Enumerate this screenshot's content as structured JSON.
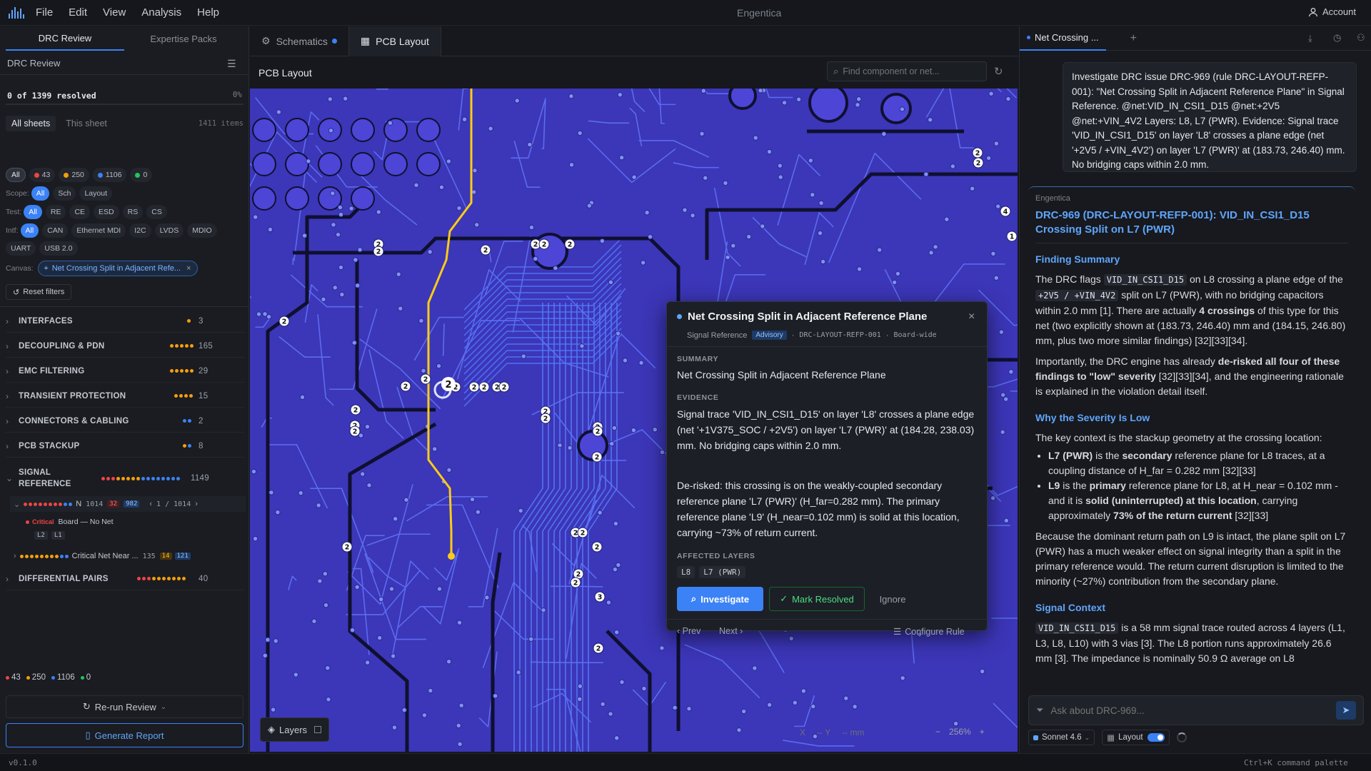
{
  "menu": {
    "items": [
      "File",
      "Edit",
      "View",
      "Analysis",
      "Help"
    ],
    "app_title": "Engentica",
    "account": "Account"
  },
  "left": {
    "tabs": [
      "DRC Review",
      "Expertise Packs"
    ],
    "header": "DRC Review",
    "progress": {
      "text": "0 of 1399 resolved",
      "percent": "0%",
      "fraction": 0
    },
    "sheet_tabs": [
      "All sheets",
      "This sheet"
    ],
    "items_count": "1411 items",
    "severity_chips": [
      {
        "label": "All"
      },
      {
        "label": "43",
        "color": "#ef4444"
      },
      {
        "label": "250",
        "color": "#f59e0b"
      },
      {
        "label": "1106",
        "color": "#3b82f6"
      },
      {
        "label": "0",
        "color": "#22c55e"
      }
    ],
    "scope": {
      "label": "Scope:",
      "chips": [
        "All",
        "Sch",
        "Layout"
      ]
    },
    "test": {
      "label": "Test:",
      "chips": [
        "All",
        "RE",
        "CE",
        "ESD",
        "RS",
        "CS"
      ]
    },
    "intf": {
      "label": "Intf:",
      "chips": [
        "All",
        "CAN",
        "Ethernet MDI",
        "I2C",
        "LVDS",
        "MDIO"
      ]
    },
    "intf2": {
      "chips": [
        "UART",
        "USB 2.0"
      ]
    },
    "canvas": {
      "label": "Canvas:",
      "value": "Net Crossing Split in Adjacent Refe..."
    },
    "reset": "Reset filters",
    "categories": [
      {
        "name": "INTERFACES",
        "count": "3",
        "dots": [
          "#f59e0b"
        ]
      },
      {
        "name": "DECOUPLING & PDN",
        "count": "165",
        "dots": [
          "#f59e0b",
          "#f59e0b",
          "#f59e0b",
          "#f59e0b",
          "#f59e0b"
        ]
      },
      {
        "name": "EMC FILTERING",
        "count": "29",
        "dots": [
          "#f59e0b",
          "#f59e0b",
          "#f59e0b",
          "#f59e0b",
          "#f59e0b"
        ]
      },
      {
        "name": "TRANSIENT PROTECTION",
        "count": "15",
        "dots": [
          "#f59e0b",
          "#f59e0b",
          "#f59e0b",
          "#f59e0b"
        ]
      },
      {
        "name": "CONNECTORS & CABLING",
        "count": "2",
        "dots": [
          "#3b82f6",
          "#3b82f6"
        ]
      },
      {
        "name": "PCB STACKUP",
        "count": "8",
        "dots": [
          "#f59e0b",
          "#3b82f6"
        ]
      }
    ],
    "signal_ref": {
      "name1": "SIGNAL",
      "name2": "REFERENCE",
      "count": "1149"
    },
    "sub1": {
      "label": "N",
      "count": "1014",
      "red": "32",
      "blue": "982",
      "pager": "1 / 1014"
    },
    "item": {
      "severity": "Critical",
      "text": "Board — No Net",
      "layers": [
        "L2",
        "L1"
      ]
    },
    "sub2": {
      "label": "Critical Net Near ...",
      "count": "135",
      "amber": "14",
      "blue": "121"
    },
    "diff": {
      "name": "DIFFERENTIAL PAIRS",
      "count": "40"
    },
    "footer_counts": [
      {
        "label": "43",
        "color": "#ef4444"
      },
      {
        "label": "250",
        "color": "#f59e0b"
      },
      {
        "label": "1106",
        "color": "#3b82f6"
      },
      {
        "label": "0",
        "color": "#22c55e"
      }
    ],
    "rerun": "Re-run Review",
    "generate": "Generate Report"
  },
  "center": {
    "tabs": [
      "Schematics",
      "PCB Layout"
    ],
    "title": "PCB Layout",
    "search_placeholder": "Find component or net...",
    "layers_btn": "Layers",
    "coords": {
      "x": "X",
      "y": "-- Y",
      "unit": "-- mm"
    },
    "zoom": "256%",
    "popup": {
      "title": "Net Crossing Split in Adjacent Reference Plane",
      "category": "Signal Reference",
      "badge": "Advisory",
      "rule": "DRC-LAYOUT-REFP-001",
      "scope": "Board-wide",
      "summary_label": "SUMMARY",
      "summary": "Net Crossing Split in Adjacent Reference Plane",
      "evidence_label": "EVIDENCE",
      "evidence1": "Signal trace 'VID_IN_CSI1_D15' on layer 'L8' crosses a plane edge (net '+1V375_SOC / +2V5') on layer 'L7 (PWR)' at (184.28, 238.03) mm. No bridging caps within 2.0 mm.",
      "evidence2": "De-risked: this crossing is on the weakly-coupled secondary reference plane 'L7 (PWR)' (H_far=0.282 mm). The primary reference plane 'L9' (H_near=0.102 mm) is solid at this location, carrying ~73% of return current.",
      "affected_label": "AFFECTED LAYERS",
      "layers": [
        "L8",
        "L7 (PWR)"
      ],
      "investigate": "Investigate",
      "mark_resolved": "Mark Resolved",
      "ignore": "Ignore",
      "prev": "‹ Prev",
      "next": "Next ›",
      "configure": "Configure Rule"
    }
  },
  "right": {
    "tab": "Net Crossing ...",
    "query": "Investigate DRC issue DRC-969 (rule DRC-LAYOUT-REFP-001): \"Net Crossing Split in Adjacent Reference Plane\" in Signal Reference. @net:VID_IN_CSI1_D15 @net:+2V5 @net:+VIN_4V2 Layers: L8, L7 (PWR). Evidence: Signal trace 'VID_IN_CSI1_D15' on layer 'L8' crosses a plane edge (net '+2V5 / +VIN_4V2') on layer 'L7 (PWR)' at (183.73, 246.40) mm. No bridging caps within 2.0 mm.",
    "author": "Engentica",
    "heading": "DRC-969 (DRC-LAYOUT-REFP-001): VID_IN_CSI1_D15 Crossing Split on L7 (PWR)",
    "s1": "Finding Summary",
    "p1a": "The DRC flags",
    "p1code1": "VID_IN_CSI1_D15",
    "p1b": "on L8 crossing a plane edge of the",
    "p1code2": "+2V5 / +VIN_4V2",
    "p1c": "split on L7 (PWR), with no bridging capacitors within 2.0 mm [1]. There are actually",
    "p1bold": "4 crossings",
    "p1d": "of this type for this net (two explicitly shown at (183.73, 246.40) mm and (184.15, 246.80) mm, plus two more similar findings) [32][33][34].",
    "p2a": "Importantly, the DRC engine has already",
    "p2bold": "de-risked all four of these findings to \"low\" severity",
    "p2b": "[32][33][34], and the engineering rationale is explained in the violation detail itself.",
    "s2": "Why the Severity Is Low",
    "p3": "The key context is the stackup geometry at the crossing location:",
    "b1bold": "L7 (PWR)",
    "b1a": "is the",
    "b1bold2": "secondary",
    "b1b": "reference plane for L8 traces, at a coupling distance of H_far = 0.282 mm [32][33]",
    "b2bold": "L9",
    "b2a": "is the",
    "b2bold2": "primary",
    "b2b": "reference plane for L8, at H_near = 0.102 mm - and it is",
    "b2bold3": "solid (uninterrupted) at this location",
    "b2c": ", carrying approximately",
    "b2bold4": "73% of the return current",
    "b2d": "[32][33]",
    "p4": "Because the dominant return path on L9 is intact, the plane split on L7 (PWR) has a much weaker effect on signal integrity than a split in the primary reference would. The return current disruption is limited to the minority (~27%) contribution from the secondary plane.",
    "s3": "Signal Context",
    "p5code": "VID_IN_CSI1_D15",
    "p5": "is a 58 mm signal trace routed across 4 layers (L1, L3, L8, L10) with 3 vias [3]. The L8 portion runs approximately 26.6 mm [3]. The impedance is nominally 50.9 Ω average on L8",
    "ask_placeholder": "Ask about DRC-969...",
    "model": "Sonnet 4.6",
    "layout_toggle": "Layout"
  },
  "status": {
    "version": "v0.1.0",
    "hint": "Ctrl+K command palette"
  },
  "board": {
    "markers": [
      "2",
      "2",
      "2",
      "2",
      "2",
      "2",
      "2",
      "2",
      "2",
      "2",
      "2",
      "2",
      "2",
      "2",
      "2",
      "2",
      "2",
      "2",
      "2",
      "2",
      "2",
      "2",
      "2",
      "2",
      "2",
      "2",
      "2",
      "2",
      "3",
      "2",
      "2",
      "2",
      "4",
      "1",
      "2",
      "2",
      "2"
    ]
  }
}
